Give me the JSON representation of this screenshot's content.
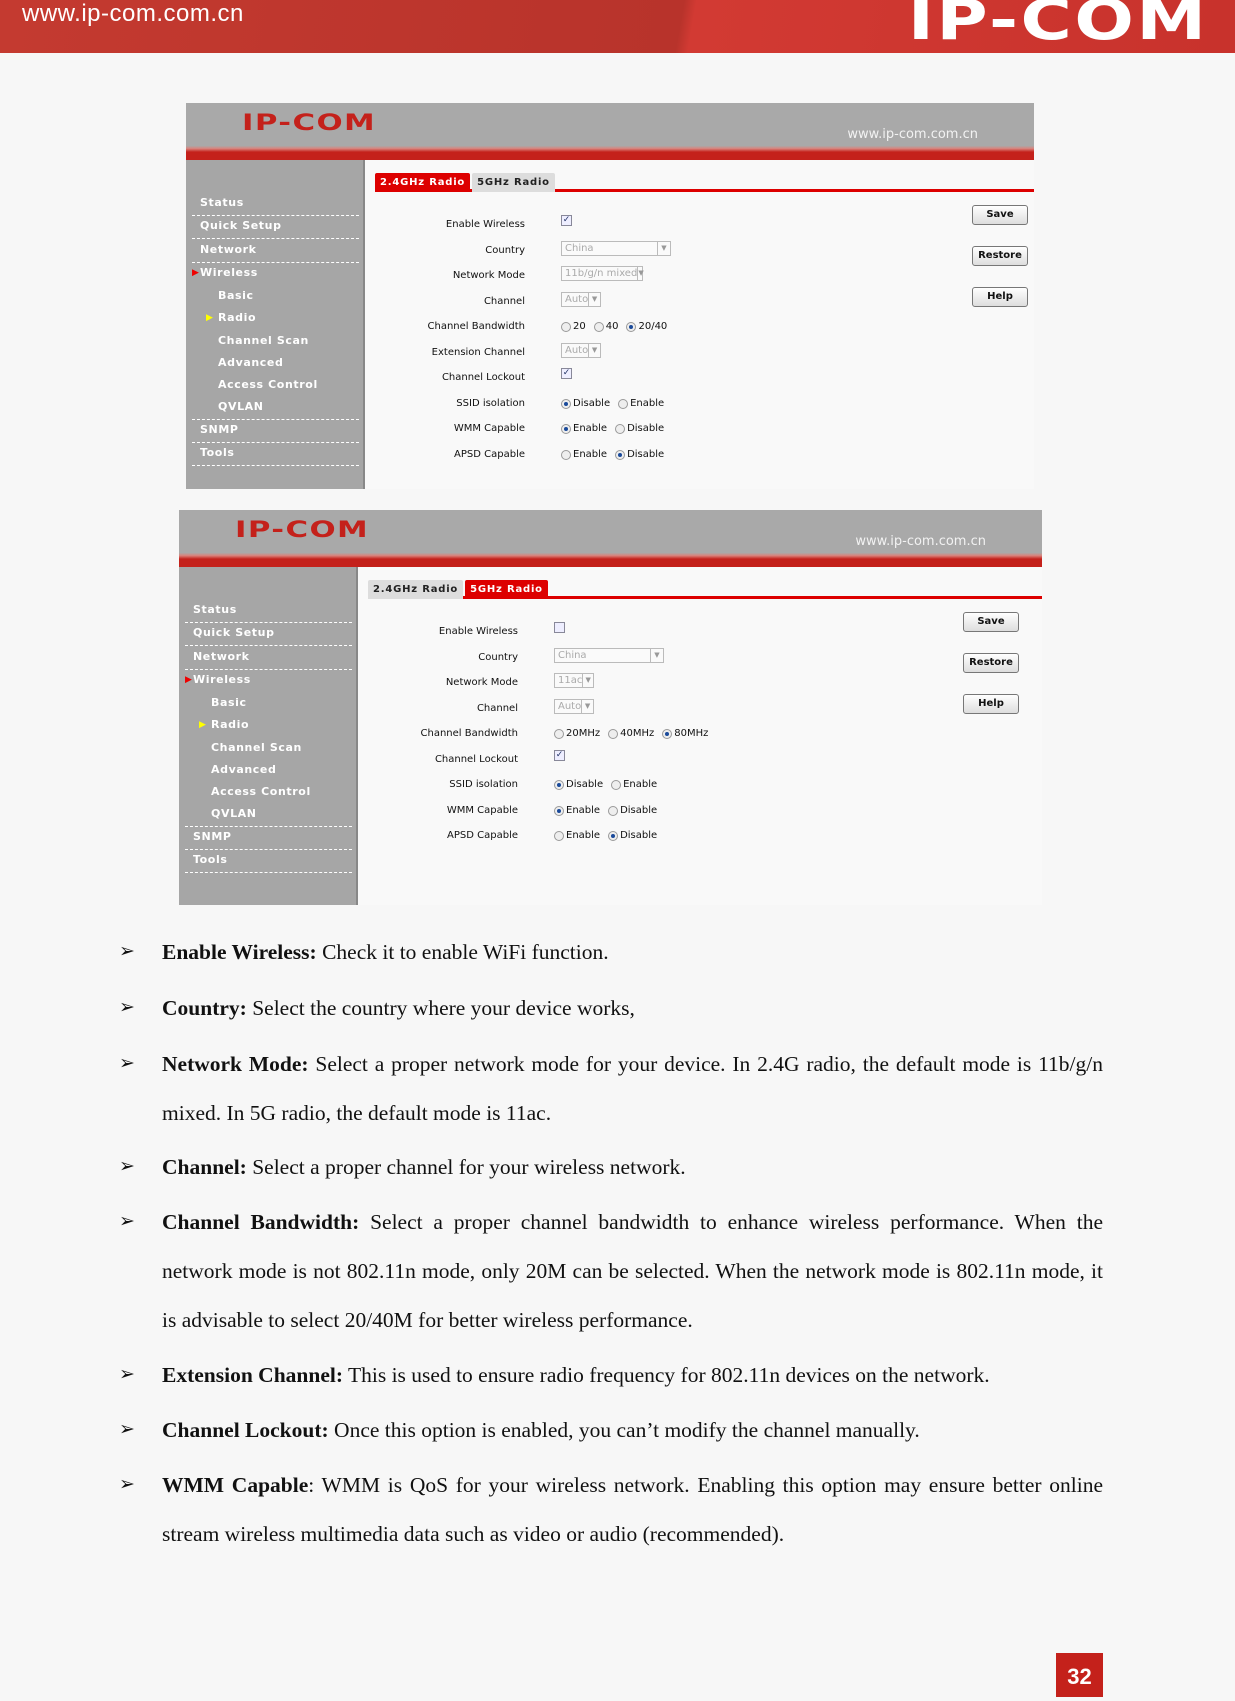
{
  "banner": {
    "url": "www.ip-com.com.cn",
    "logo": "IP-COM"
  },
  "panels": [
    {
      "logo": "IP-COM",
      "url": "www.ip-com.com.cn",
      "sidebar": [
        {
          "label": "Status"
        },
        {
          "label": "Quick Setup"
        },
        {
          "label": "Network"
        },
        {
          "label": "Wireless",
          "active": true
        },
        {
          "label": "Basic",
          "sub": true
        },
        {
          "label": "Radio",
          "sub": true,
          "active": true
        },
        {
          "label": "Channel Scan",
          "sub": true
        },
        {
          "label": "Advanced",
          "sub": true
        },
        {
          "label": "Access Control",
          "sub": true
        },
        {
          "label": "QVLAN",
          "sub": true
        },
        {
          "label": "SNMP"
        },
        {
          "label": "Tools"
        }
      ],
      "tabs": [
        {
          "label": "2.4GHz Radio",
          "active": true
        },
        {
          "label": "5GHz Radio",
          "active": false
        }
      ],
      "rows": [
        {
          "label": "Enable Wireless",
          "type": "checkbox",
          "checked": true
        },
        {
          "label": "Country",
          "type": "select",
          "value": "China"
        },
        {
          "label": "Network Mode",
          "type": "select",
          "value": "11b/g/n mixed"
        },
        {
          "label": "Channel",
          "type": "select",
          "value": "Auto"
        },
        {
          "label": "Channel Bandwidth",
          "type": "radio",
          "options": [
            "20",
            "40",
            "20/40"
          ],
          "selected": 2
        },
        {
          "label": "Extension Channel",
          "type": "select",
          "value": "Auto"
        },
        {
          "label": "Channel Lockout",
          "type": "checkbox",
          "checked": true
        },
        {
          "label": "SSID isolation",
          "type": "radio",
          "options": [
            "Disable",
            "Enable"
          ],
          "selected": 0
        },
        {
          "label": "WMM Capable",
          "type": "radio",
          "options": [
            "Enable",
            "Disable"
          ],
          "selected": 0
        },
        {
          "label": "APSD Capable",
          "type": "radio",
          "options": [
            "Enable",
            "Disable"
          ],
          "selected": 1
        }
      ],
      "buttons": [
        "Save",
        "Restore",
        "Help"
      ]
    },
    {
      "logo": "IP-COM",
      "url": "www.ip-com.com.cn",
      "sidebar": [
        {
          "label": "Status"
        },
        {
          "label": "Quick Setup"
        },
        {
          "label": "Network"
        },
        {
          "label": "Wireless",
          "active": true
        },
        {
          "label": "Basic",
          "sub": true
        },
        {
          "label": "Radio",
          "sub": true,
          "active": true
        },
        {
          "label": "Channel Scan",
          "sub": true
        },
        {
          "label": "Advanced",
          "sub": true
        },
        {
          "label": "Access Control",
          "sub": true
        },
        {
          "label": "QVLAN",
          "sub": true
        },
        {
          "label": "SNMP"
        },
        {
          "label": "Tools"
        }
      ],
      "tabs": [
        {
          "label": "2.4GHz Radio",
          "active": false
        },
        {
          "label": "5GHz Radio",
          "active": true
        }
      ],
      "rows": [
        {
          "label": "Enable Wireless",
          "type": "checkbox",
          "checked": false
        },
        {
          "label": "Country",
          "type": "select",
          "value": "China"
        },
        {
          "label": "Network Mode",
          "type": "select",
          "value": "11ac"
        },
        {
          "label": "Channel",
          "type": "select",
          "value": "Auto"
        },
        {
          "label": "Channel Bandwidth",
          "type": "radio",
          "options": [
            "20MHz",
            "40MHz",
            "80MHz"
          ],
          "selected": 2
        },
        {
          "label": "Channel Lockout",
          "type": "checkbox",
          "checked": true
        },
        {
          "label": "SSID isolation",
          "type": "radio",
          "options": [
            "Disable",
            "Enable"
          ],
          "selected": 0
        },
        {
          "label": "WMM Capable",
          "type": "radio",
          "options": [
            "Enable",
            "Disable"
          ],
          "selected": 0
        },
        {
          "label": "APSD Capable",
          "type": "radio",
          "options": [
            "Enable",
            "Disable"
          ],
          "selected": 1
        }
      ],
      "buttons": [
        "Save",
        "Restore",
        "Help"
      ]
    }
  ],
  "bullets": [
    {
      "term": "Enable Wireless:",
      "text": " Check it to enable WiFi function."
    },
    {
      "term": "Country:",
      "text": " Select the country where your device works,"
    },
    {
      "term": "Network Mode:",
      "text": " Select a proper network mode for your device. In 2.4G radio, the default mode is 11b/g/n mixed. In 5G radio, the default mode is 11ac."
    },
    {
      "term": "Channel:",
      "text": " Select a proper channel for your wireless network."
    },
    {
      "term": "Channel Bandwidth:",
      "text": " Select a proper channel bandwidth to enhance wireless performance. When the network mode is not 802.11n mode, only 20M can be selected. When the network mode is 802.11n mode, it is advisable to select 20/40M for better wireless performance."
    },
    {
      "term": "Extension Channel:",
      "text": " This is used to ensure radio frequency for 802.11n devices on the network."
    },
    {
      "term": "Channel Lockout:",
      "text": " Once this option is enabled, you can’t modify the channel manually."
    },
    {
      "term": "WMM Capable",
      "text": ": WMM is QoS for your wireless network. Enabling this option may ensure better online stream wireless multimedia data such as video or audio (recommended)."
    }
  ],
  "bullet_glyph": "➢",
  "page_number": "32",
  "colors": {
    "brand_red": "#c4211b",
    "sidebar_gray": "#a6a6a6"
  }
}
